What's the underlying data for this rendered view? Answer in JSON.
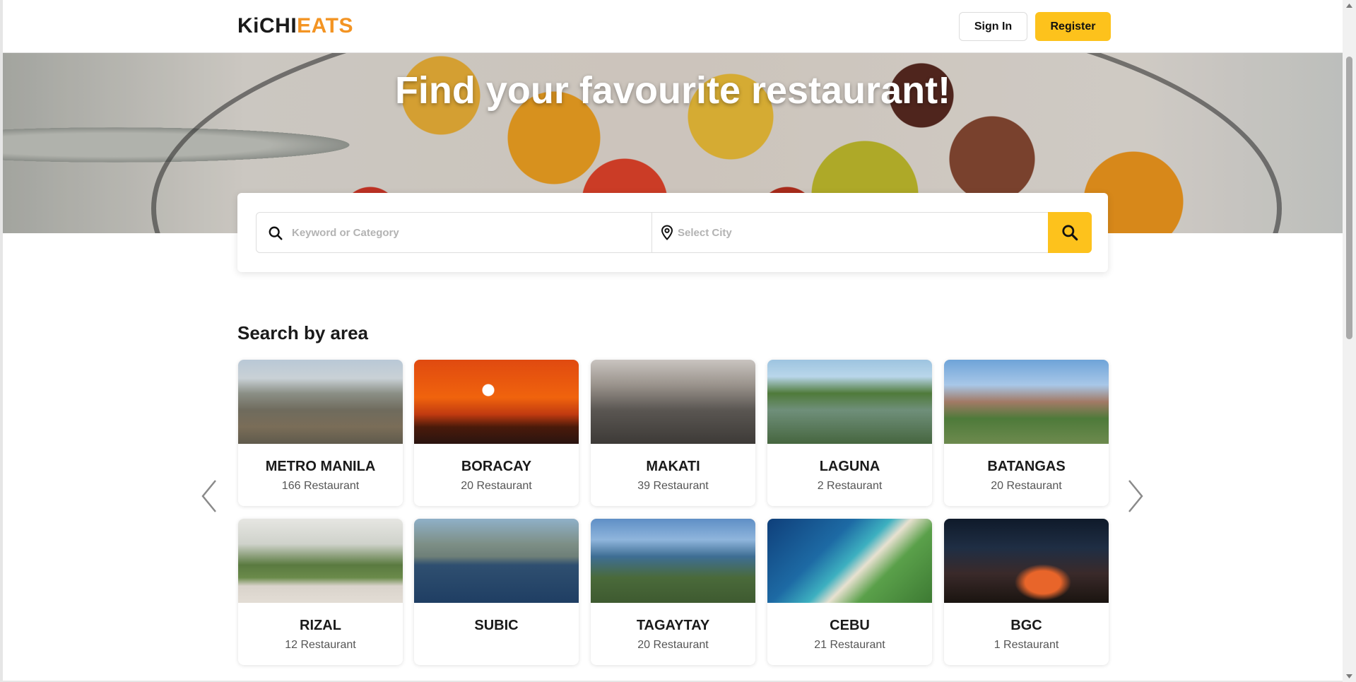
{
  "header": {
    "logo_part1": "KiCHI",
    "logo_part2": "EATS",
    "signin_label": "Sign In",
    "register_label": "Register"
  },
  "hero": {
    "title": "Find your favourite restaurant!"
  },
  "search": {
    "keyword_placeholder": "Keyword or Category",
    "city_placeholder": "Select City",
    "search_icon": "search-icon",
    "location_icon": "map-pin-icon"
  },
  "areas": {
    "title": "Search by area",
    "prev_icon": "chevron-left-icon",
    "next_icon": "chevron-right-icon",
    "items": [
      {
        "name": "METRO MANILA",
        "count": "166 Restaurant"
      },
      {
        "name": "BORACAY",
        "count": "20 Restaurant"
      },
      {
        "name": "MAKATI",
        "count": "39 Restaurant"
      },
      {
        "name": "LAGUNA",
        "count": "2 Restaurant"
      },
      {
        "name": "BATANGAS",
        "count": "20 Restaurant"
      },
      {
        "name": "RIZAL",
        "count": "12 Restaurant"
      },
      {
        "name": "SUBIC",
        "count": ""
      },
      {
        "name": "TAGAYTAY",
        "count": "20 Restaurant"
      },
      {
        "name": "CEBU",
        "count": "21 Restaurant"
      },
      {
        "name": "BGC",
        "count": "1 Restaurant"
      }
    ]
  },
  "colors": {
    "accent": "#fdc21c",
    "logo_orange": "#f39423"
  }
}
